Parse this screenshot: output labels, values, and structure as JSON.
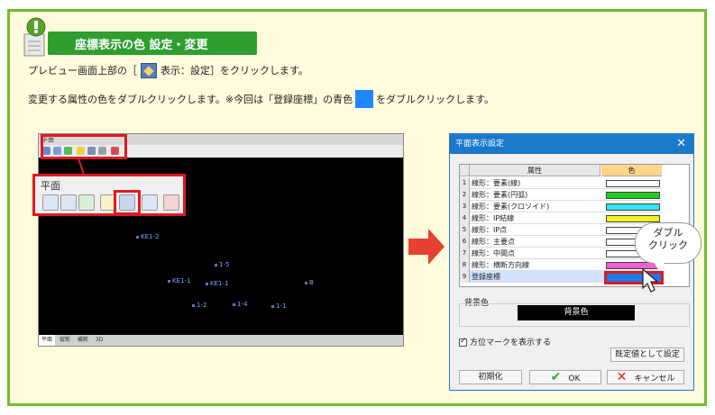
{
  "heading": {
    "title": "座標表示の色 設定・変更"
  },
  "instructions": {
    "line1_prefix": "プレビュー画面上部の［",
    "line1_icon_label": "表示：設定］をクリックします。",
    "line2_prefix": "変更する属性の色をダブルクリックします。※今回は「登録座標」の青色",
    "line2_suffix": "をダブルクリックします。"
  },
  "app": {
    "title": "平面",
    "callout_label": "平面",
    "points": [
      {
        "label": "KE1-2"
      },
      {
        "label": "1-5"
      },
      {
        "label": "KE1-1"
      },
      {
        "label": "KE1-1"
      },
      {
        "label": "B"
      },
      {
        "label": "1-2"
      },
      {
        "label": "1-4"
      },
      {
        "label": "1-1"
      }
    ],
    "status_tabs": [
      "平面",
      "縦断",
      "横断",
      "3D"
    ]
  },
  "dialog": {
    "title": "平面表示設定",
    "close_glyph": "✕",
    "headers": {
      "attr": "属性",
      "color": "色"
    },
    "rows": [
      {
        "num": "1",
        "label": "線形：要素(線)",
        "color": "#ffffff"
      },
      {
        "num": "2",
        "label": "線形：要素(円弧)",
        "color": "#22cc22"
      },
      {
        "num": "3",
        "label": "線形：要素(クロソイド)",
        "color": "#2ee5f0"
      },
      {
        "num": "4",
        "label": "線形：IP結線",
        "color": "#f2f21c"
      },
      {
        "num": "5",
        "label": "線形：IP点",
        "color": "#ffffff"
      },
      {
        "num": "6",
        "label": "線形：主要点",
        "color": "#ffffff"
      },
      {
        "num": "7",
        "label": "線形：中間点",
        "color": "#ffffff"
      },
      {
        "num": "8",
        "label": "線形：横断方向線",
        "color": "#f060d0"
      },
      {
        "num": "9",
        "label": "登録座標",
        "color": "#1e78e8"
      }
    ],
    "bg_label": "背景色",
    "bg_swatch": "背景色",
    "checkbox_label": "方位マークを表示する",
    "buttons": {
      "default": "既定値として設定",
      "init": "初期化",
      "ok": "OK",
      "cancel": "キャンセル"
    },
    "ok_mark": "✔",
    "cancel_mark": "✕"
  },
  "bubble": {
    "line1": "ダブル",
    "line2": "クリック"
  }
}
